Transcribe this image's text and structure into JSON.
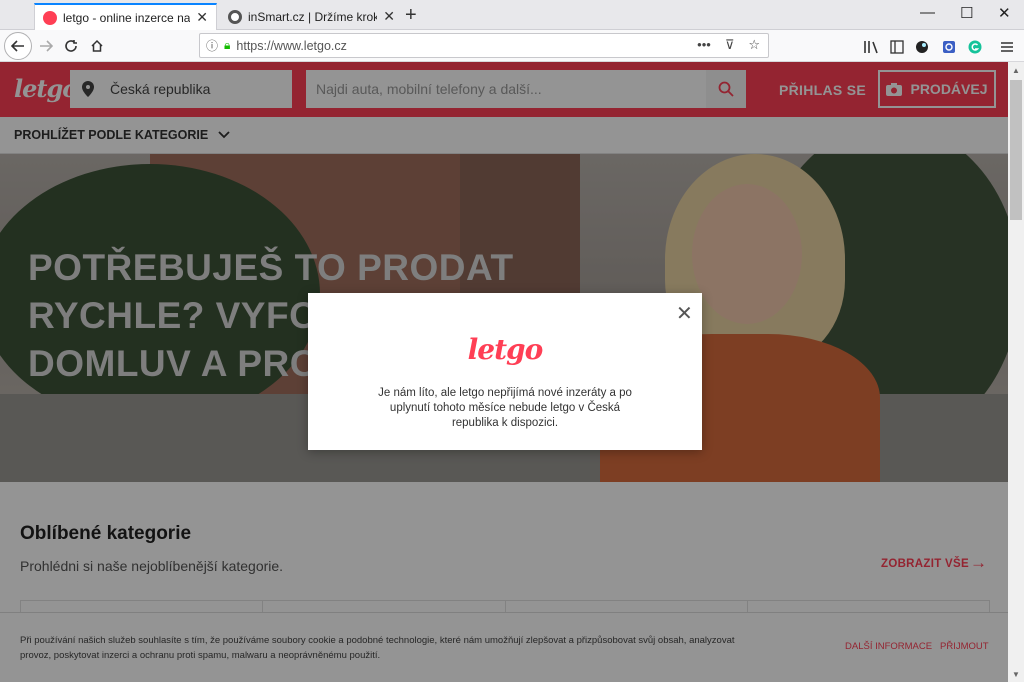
{
  "browser": {
    "tabs": [
      {
        "title": "letgo - online inzerce na prodá",
        "favicon_color": "#ff3f55"
      },
      {
        "title": "inSmart.cz | Držíme krok s dob",
        "favicon_color": "#555555"
      }
    ],
    "new_tab_label": "+",
    "window_controls": {
      "minimize": "—",
      "maximize": "☐",
      "close": "✕"
    },
    "url": "https://www.letgo.cz",
    "url_icons": {
      "more": "•••",
      "pocket": "⊽",
      "star": "☆"
    }
  },
  "header": {
    "logo": "letgo",
    "location": "Česká republika",
    "search_placeholder": "Najdi auta, mobilní telefony a další...",
    "login": "PŘIHLAS SE",
    "sell": "PRODÁVEJ"
  },
  "subnav": {
    "label": "PROHLÍŽET PODLE KATEGORIE"
  },
  "hero": {
    "line1": "POTŘEBUJEŠ TO PRODAT",
    "line2": "RYCHLE? VYFO",
    "line3": "DOMLUV A PRO"
  },
  "categories": {
    "title": "Oblíbené kategorie",
    "subtitle": "Prohlédni si naše nejoblíbenější kategorie.",
    "view_all": "ZOBRAZIT VŠE"
  },
  "cookie": {
    "text": "Při používání našich služeb souhlasíte s tím, že používáme soubory cookie a podobné technologie, které nám umožňují zlepšovat a přizpůsobovat svůj obsah, analyzovat provoz, poskytovat inzerci a ochranu proti spamu, malwaru a neoprávněnému použití.",
    "more": "DALŠÍ INFORMACE",
    "accept": "PŘIJMOUT"
  },
  "modal": {
    "logo": "letgo",
    "message": "Je nám líto, ale letgo nepřijímá nové inzeráty a po uplynutí tohoto měsíce nebude letgo v Česká republika k dispozici.",
    "close": "✕"
  },
  "colors": {
    "brand": "#ff3f55",
    "overlay": "rgba(0,0,0,0.42)"
  }
}
